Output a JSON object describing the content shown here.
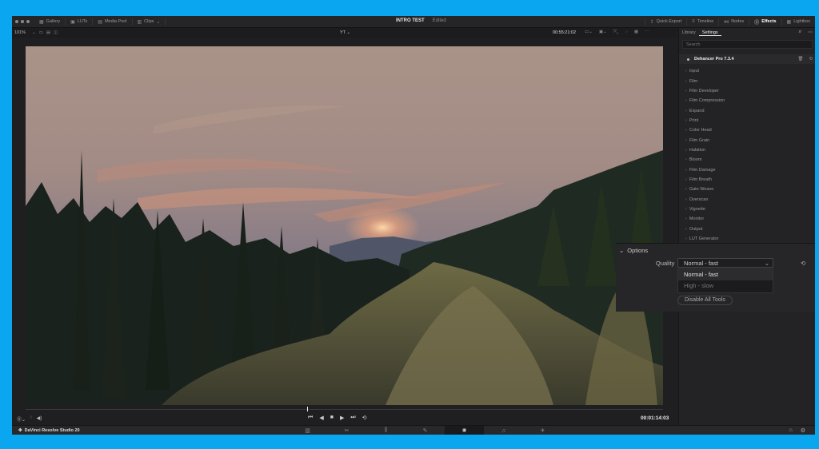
{
  "topbar": {
    "left_items": [
      {
        "icon": "gallery-icon",
        "label": "Gallery"
      },
      {
        "icon": "luts-icon",
        "label": "LUTs"
      },
      {
        "icon": "media-pool-icon",
        "label": "Media Pool"
      },
      {
        "icon": "clips-icon",
        "label": "Clips"
      }
    ],
    "project_title": "INTRO TEST",
    "project_status": "Edited",
    "right_items": [
      {
        "icon": "quick-export-icon",
        "label": "Quick Export"
      },
      {
        "icon": "timeline-icon",
        "label": "Timeline"
      },
      {
        "icon": "nodes-icon",
        "label": "Nodes"
      },
      {
        "icon": "effects-icon",
        "label": "Effects"
      },
      {
        "icon": "lightbox-icon",
        "label": "Lightbox"
      }
    ]
  },
  "viewer_bar": {
    "zoom": "101%",
    "clip_name": "YT",
    "timecode": "00:55:21:02"
  },
  "transport": {
    "timecode": "00:01:14:03",
    "controls": [
      "first-frame-icon",
      "play-reverse-icon",
      "stop-icon",
      "play-icon",
      "last-frame-icon",
      "loop-icon"
    ]
  },
  "bottombar": {
    "brand": "DaVinci Resolve Studio 20",
    "pages": [
      "media-page-icon",
      "cut-page-icon",
      "edit-page-icon",
      "fusion-page-icon",
      "color-page-icon",
      "fairlight-page-icon",
      "deliver-page-icon"
    ],
    "active_page": 4
  },
  "panel": {
    "tabs": [
      "Library",
      "Settings"
    ],
    "active_tab": 1,
    "search_placeholder": "Search",
    "plugin_name": "Dehancer Pro 7.3.4",
    "tools": [
      "Input",
      "Film",
      "Film Developer",
      "Film Compression",
      "Expand",
      "Print",
      "Color Head",
      "Film Grain",
      "Halation",
      "Bloom",
      "Film Damage",
      "Film Breath",
      "Gate Weave",
      "Overscan",
      "Vignette",
      "Monitor",
      "Output",
      "LUT Generator"
    ]
  },
  "options": {
    "title": "Options",
    "quality_label": "Quality",
    "quality_value": "Normal - fast",
    "quality_options": [
      "Normal - fast",
      "High - slow"
    ],
    "disable_button": "Disable All Tools"
  },
  "colors": {
    "background": "#0aa6f0",
    "window": "#1f1f21",
    "panel": "#232325"
  }
}
